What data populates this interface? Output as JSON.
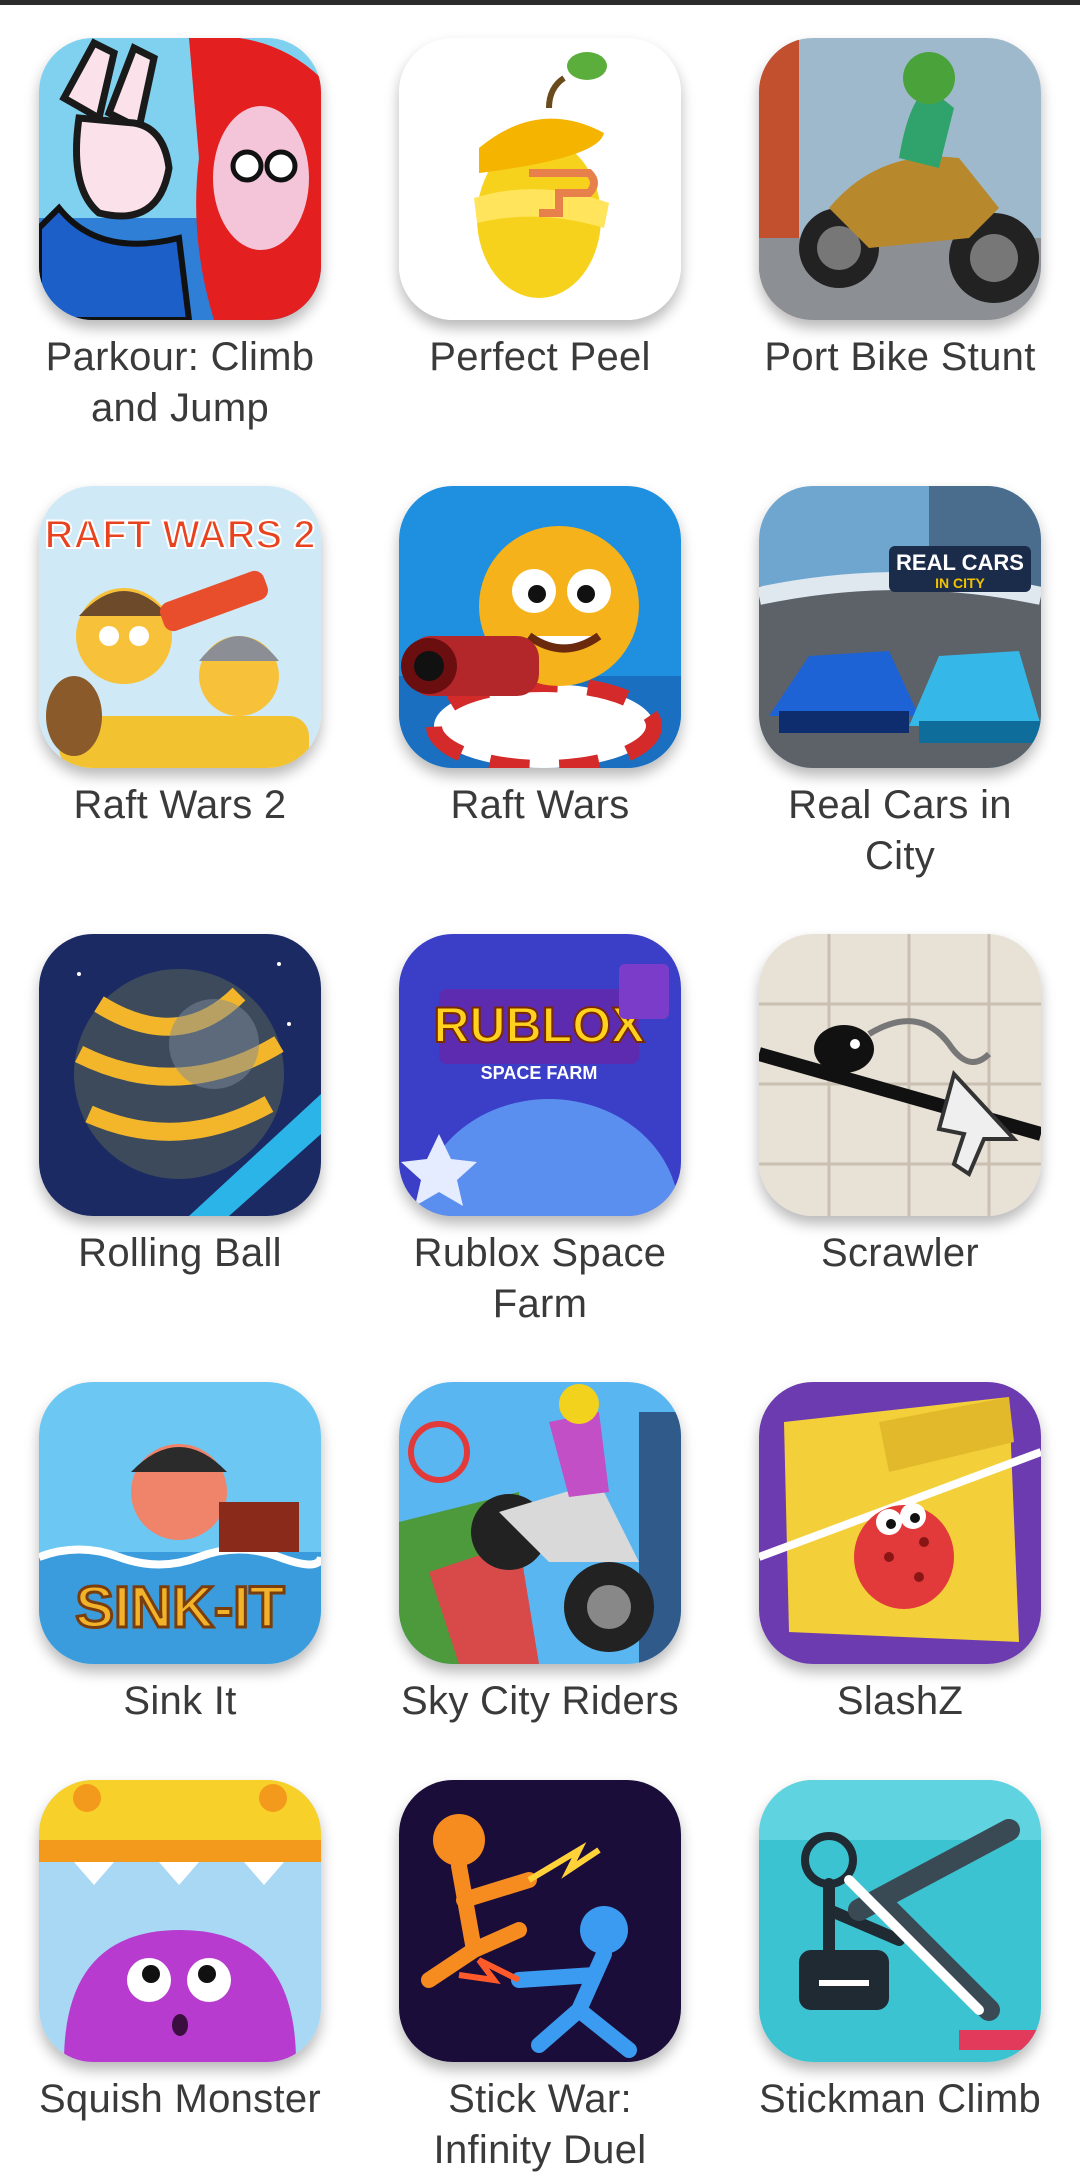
{
  "games": [
    {
      "title": "Parkour: Climb and Jump"
    },
    {
      "title": "Perfect Peel"
    },
    {
      "title": "Port Bike Stunt"
    },
    {
      "title": "Raft Wars 2",
      "art_text": "RAFT WARS 2"
    },
    {
      "title": "Raft Wars"
    },
    {
      "title": "Real Cars in City",
      "art_text": "REAL CARS",
      "art_subtext": "IN CITY"
    },
    {
      "title": "Rolling Ball"
    },
    {
      "title": "Rublox Space Farm",
      "art_text": "RUBLOX",
      "art_subtext": "SPACE FARM"
    },
    {
      "title": "Scrawler"
    },
    {
      "title": "Sink It",
      "art_text": "SINK-IT"
    },
    {
      "title": "Sky City Riders"
    },
    {
      "title": "SlashZ"
    },
    {
      "title": "Squish Monster"
    },
    {
      "title": "Stick War: Infinity Duel"
    },
    {
      "title": "Stickman Climb"
    }
  ],
  "colors": {
    "top_bar": "#2c2c2c",
    "label_text": "#3a3a3a",
    "background": "#ffffff"
  }
}
